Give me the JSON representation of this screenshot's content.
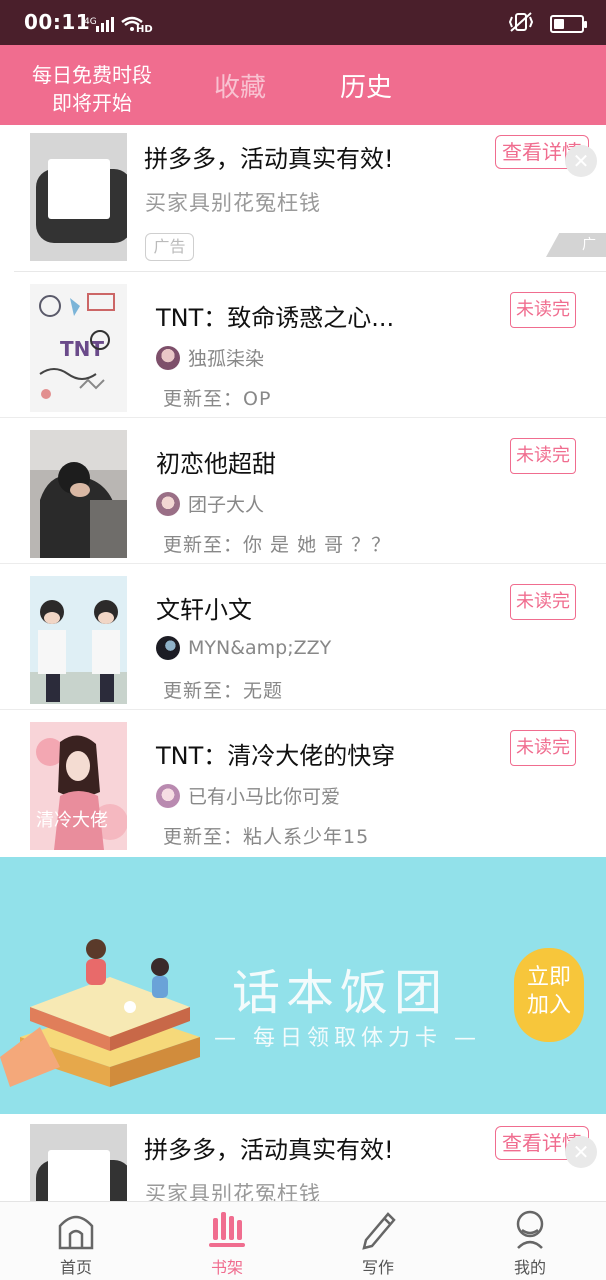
{
  "status_bar": {
    "time": "00:11",
    "network": "4G",
    "hd": "HD"
  },
  "header": {
    "promo_line1": "每日免费时段",
    "promo_line2": "即将开始",
    "tab_favorites": "收藏",
    "tab_history": "历史"
  },
  "ad_top": {
    "title": "拼多多，活动真实有效!",
    "subtitle": "买家具别花冤枉钱",
    "tag": "广告",
    "cta": "查看详情",
    "mark": "广告"
  },
  "books": [
    {
      "title": "TNT：致命诱惑之心...",
      "author": "独孤柒染",
      "update": "更新至：OP",
      "status": "未读完"
    },
    {
      "title": "初恋他超甜",
      "author": "团子大人",
      "update": "更新至：你 是 她 哥 ？？",
      "status": "未读完"
    },
    {
      "title": "文轩小文",
      "author": "MYN&amp;ZZY",
      "update": "更新至：无题",
      "status": "未读完"
    },
    {
      "title": "TNT：清冷大佬的快穿",
      "author": "已有小马比你可爱",
      "update": "更新至：粘人系少年15",
      "status": "未读完"
    }
  ],
  "banner": {
    "title": "话本饭团",
    "subtitle": "— 每日领取体力卡 —",
    "button_line1": "立即",
    "button_line2": "加入"
  },
  "ad_bottom": {
    "title": "拼多多，活动真实有效!",
    "subtitle": "买家具别花冤枉钱",
    "cta": "查看详情"
  },
  "bottom_nav": [
    {
      "label": "首页",
      "icon": "home-icon"
    },
    {
      "label": "书架",
      "icon": "bookshelf-icon"
    },
    {
      "label": "写作",
      "icon": "pen-icon"
    },
    {
      "label": "我的",
      "icon": "profile-icon"
    }
  ],
  "colors": {
    "accent": "#f06d8f",
    "statusbar": "#4a1f2b",
    "banner": "#92e1ea",
    "join": "#f7c63b"
  }
}
